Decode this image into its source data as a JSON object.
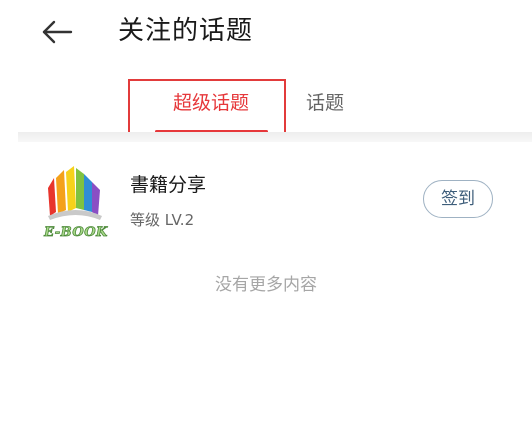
{
  "header": {
    "back_icon": "arrow-left-icon",
    "title": "关注的话题"
  },
  "tabs": [
    {
      "label": "超级话题",
      "active": true
    },
    {
      "label": "话题",
      "active": false
    }
  ],
  "topics": [
    {
      "logo_icon": "e-book-logo",
      "logo_text": "E-BOOK",
      "name": "書籍分享",
      "level": "等级 LV.2",
      "action_label": "签到"
    }
  ],
  "list_footer": "没有更多内容",
  "colors": {
    "accent": "#e6373a",
    "highlight_box": "#e23b3b",
    "button_border": "#9fb2c3",
    "button_text": "#3d5d7a",
    "muted_text": "#a6a6a6"
  }
}
